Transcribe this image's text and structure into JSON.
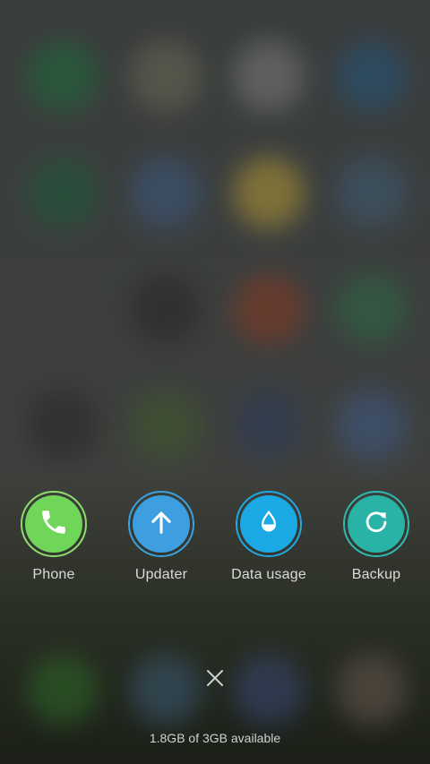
{
  "recent_apps": [
    {
      "label": "Phone",
      "icon": "phone-icon",
      "color": "#6fd65a",
      "ring": "#8edc6e"
    },
    {
      "label": "Updater",
      "icon": "arrow-up-icon",
      "color": "#3d9fe0",
      "ring": "#3aa2de"
    },
    {
      "label": "Data usage",
      "icon": "water-drop-icon",
      "color": "#1aa9e4",
      "ring": "#1fa8e2"
    },
    {
      "label": "Backup",
      "icon": "refresh-icon",
      "color": "#29b3a7",
      "ring": "#2fbab0"
    }
  ],
  "close_icon": "close-icon",
  "memory_status": "1.8GB of 3GB available"
}
